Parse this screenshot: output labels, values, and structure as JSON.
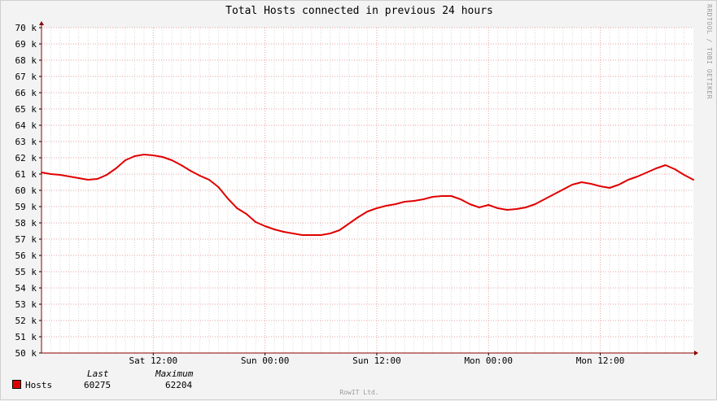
{
  "chart_data": {
    "type": "line",
    "title": "Total Hosts connected in previous 24 hours",
    "ylim": [
      50000,
      70000
    ],
    "y_ticks": [
      50000,
      51000,
      52000,
      53000,
      54000,
      55000,
      56000,
      57000,
      58000,
      59000,
      60000,
      61000,
      62000,
      63000,
      64000,
      65000,
      66000,
      67000,
      68000,
      69000,
      70000
    ],
    "y_tick_labels": [
      "50 k",
      "51 k",
      "52 k",
      "53 k",
      "54 k",
      "55 k",
      "56 k",
      "57 k",
      "58 k",
      "59 k",
      "60 k",
      "61 k",
      "62 k",
      "63 k",
      "64 k",
      "65 k",
      "66 k",
      "67 k",
      "68 k",
      "69 k",
      "70 k"
    ],
    "x_ticks": [
      "Sat 12:00",
      "Sun 00:00",
      "Sun 12:00",
      "Mon 00:00",
      "Mon 12:00"
    ],
    "xlim_hours": [
      0,
      70
    ],
    "x_tick_hours": [
      12,
      24,
      36,
      48,
      60
    ],
    "grid": true,
    "series": [
      {
        "name": "Hosts",
        "color": "#e00000",
        "x": [
          0,
          1,
          2,
          3,
          4,
          5,
          6,
          7,
          8,
          9,
          10,
          11,
          12,
          13,
          14,
          15,
          16,
          17,
          18,
          19,
          20,
          21,
          22,
          23,
          24,
          25,
          26,
          27,
          28,
          29,
          30,
          31,
          32,
          33,
          34,
          35,
          36,
          37,
          38,
          39,
          40,
          41,
          42,
          43,
          44,
          45,
          46,
          47,
          48,
          49,
          50,
          51,
          52,
          53,
          54,
          55,
          56,
          57,
          58,
          59,
          60,
          61,
          62,
          63,
          64,
          65,
          66,
          67,
          68,
          69,
          70
        ],
        "values": [
          61100,
          61000,
          60950,
          60850,
          60750,
          60650,
          60700,
          60950,
          61350,
          61850,
          62100,
          62200,
          62150,
          62050,
          61850,
          61550,
          61200,
          60900,
          60650,
          60200,
          59500,
          58900,
          58550,
          58050,
          57800,
          57600,
          57450,
          57350,
          57250,
          57250,
          57250,
          57350,
          57550,
          57950,
          58350,
          58700,
          58900,
          59050,
          59150,
          59300,
          59350,
          59450,
          59600,
          59650,
          59650,
          59450,
          59150,
          58950,
          59100,
          58900,
          58800,
          58850,
          58950,
          59150,
          59450,
          59750,
          60050,
          60350,
          60500,
          60400,
          60250,
          60150,
          60350,
          60650,
          60850,
          61100,
          61350,
          61550,
          61300,
          60950,
          60650
        ]
      }
    ]
  },
  "legend": {
    "last_header": "Last",
    "max_header": "Maximum",
    "series_label": "Hosts",
    "last_value": "60275",
    "max_value": "62204"
  },
  "side_label": "RRDTOOL / TOBI OETIKER",
  "footer": "RowIT Ltd."
}
